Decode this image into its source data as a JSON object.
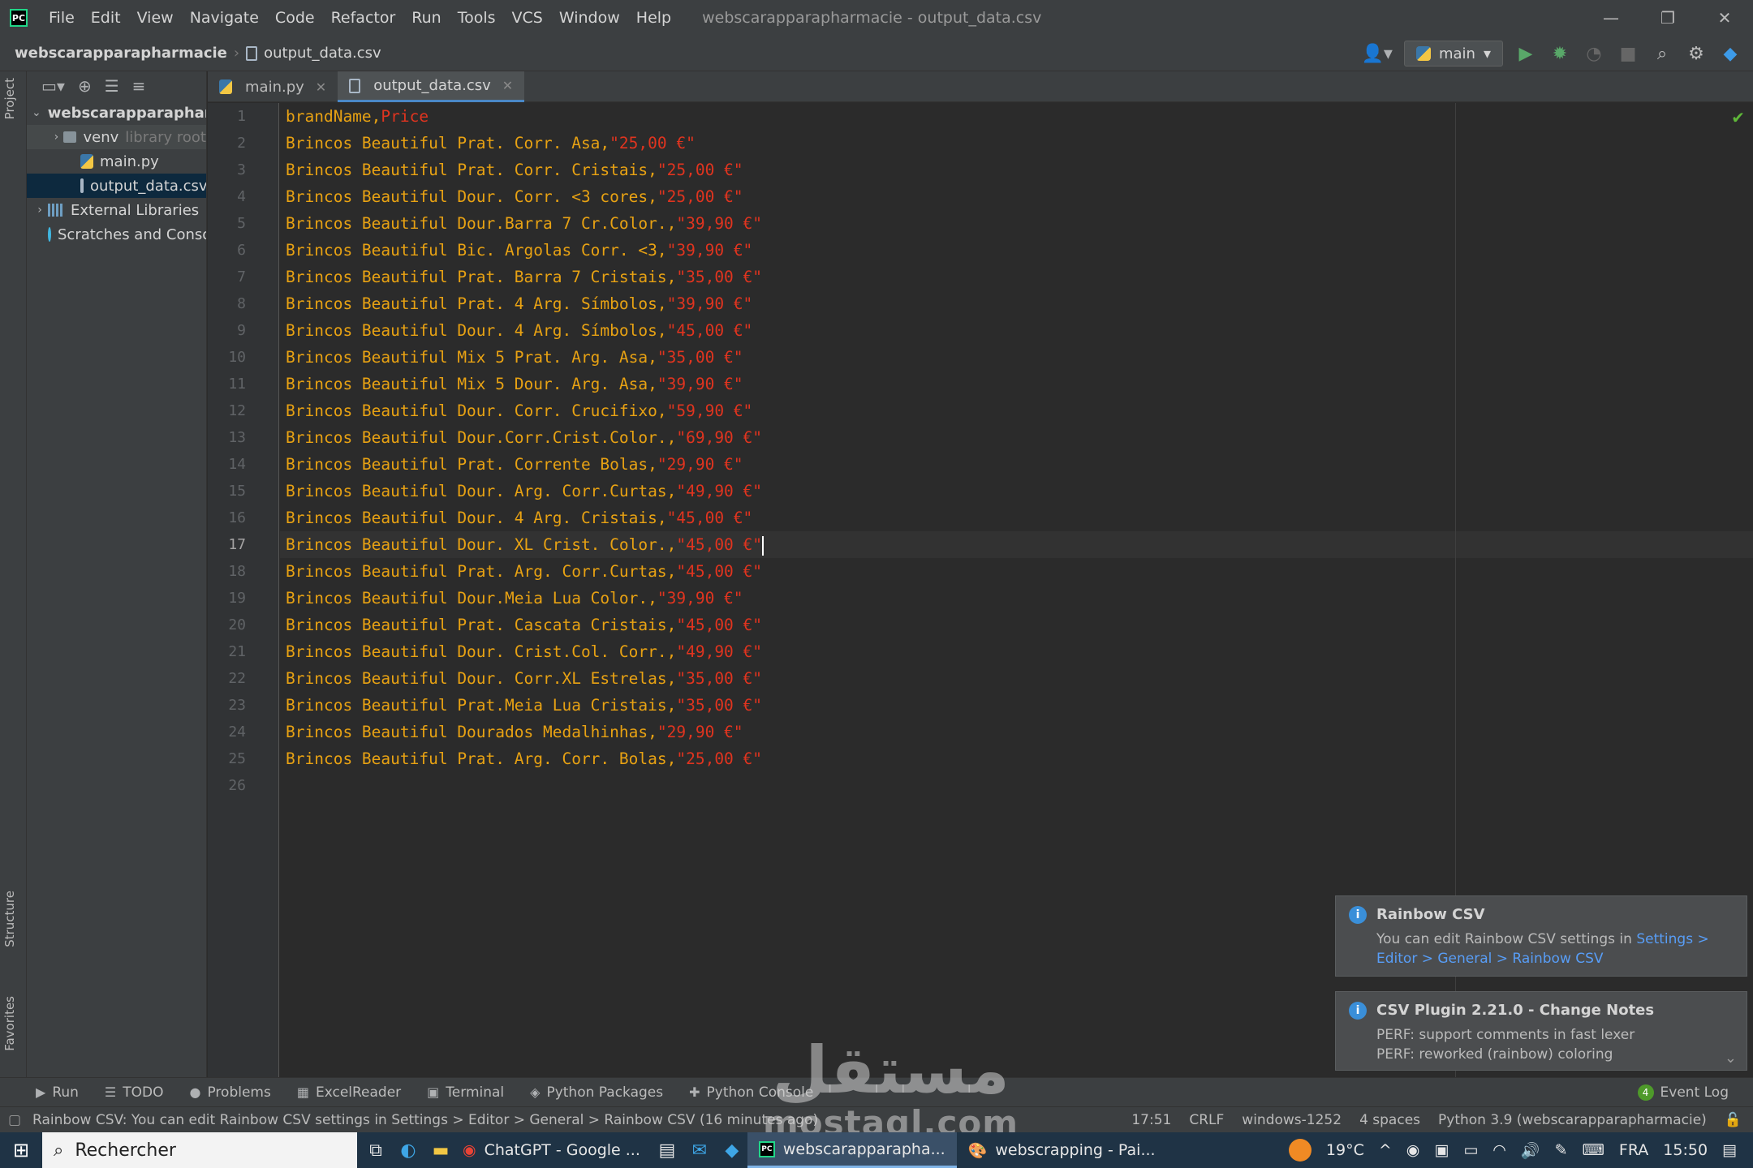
{
  "window": {
    "title": "webscarapparapharmacie - output_data.csv",
    "menu": [
      "File",
      "Edit",
      "View",
      "Navigate",
      "Code",
      "Refactor",
      "Run",
      "Tools",
      "VCS",
      "Window",
      "Help"
    ],
    "controls": {
      "minimize": "—",
      "restore": "❐",
      "close": "✕"
    }
  },
  "navbar": {
    "project": "webscarapparapharmacie",
    "file": "output_data.csv",
    "run_config": "main"
  },
  "left_strip": {
    "project": "Project",
    "structure": "Structure",
    "favorites": "Favorites"
  },
  "project_tree": {
    "root": "webscarapparapharmacie",
    "venv": "venv",
    "venv_hint": "library root",
    "main": "main.py",
    "csv": "output_data.csv",
    "libraries": "External Libraries",
    "scratches": "Scratches and Consoles"
  },
  "tabs": [
    {
      "label": "main.py"
    },
    {
      "label": "output_data.csv"
    }
  ],
  "editor": {
    "current_line": 17,
    "lines": [
      {
        "n": "1",
        "a": "brandName",
        "b": "Price"
      },
      {
        "n": "2",
        "a": "Brincos Beautiful Prat. Corr. Asa",
        "b": "\"25,00 €\""
      },
      {
        "n": "3",
        "a": "Brincos Beautiful Prat. Corr. Cristais",
        "b": "\"25,00 €\""
      },
      {
        "n": "4",
        "a": "Brincos Beautiful Dour. Corr. <3 cores",
        "b": "\"25,00 €\""
      },
      {
        "n": "5",
        "a": "Brincos Beautiful Dour.Barra 7 Cr.Color.",
        "b": "\"39,90 €\""
      },
      {
        "n": "6",
        "a": "Brincos Beautiful Bic. Argolas Corr. <3",
        "b": "\"39,90 €\""
      },
      {
        "n": "7",
        "a": "Brincos Beautiful Prat. Barra 7 Cristais",
        "b": "\"35,00 €\""
      },
      {
        "n": "8",
        "a": "Brincos Beautiful Prat. 4 Arg. Símbolos",
        "b": "\"39,90 €\""
      },
      {
        "n": "9",
        "a": "Brincos Beautiful Dour. 4 Arg. Símbolos",
        "b": "\"45,00 €\""
      },
      {
        "n": "10",
        "a": "Brincos Beautiful Mix 5 Prat. Arg. Asa",
        "b": "\"35,00 €\""
      },
      {
        "n": "11",
        "a": "Brincos Beautiful Mix 5 Dour. Arg. Asa",
        "b": "\"39,90 €\""
      },
      {
        "n": "12",
        "a": "Brincos Beautiful Dour. Corr. Crucifixo",
        "b": "\"59,90 €\""
      },
      {
        "n": "13",
        "a": "Brincos Beautiful Dour.Corr.Crist.Color.",
        "b": "\"69,90 €\""
      },
      {
        "n": "14",
        "a": "Brincos Beautiful Prat. Corrente Bolas",
        "b": "\"29,90 €\""
      },
      {
        "n": "15",
        "a": "Brincos Beautiful Dour. Arg. Corr.Curtas",
        "b": "\"49,90 €\""
      },
      {
        "n": "16",
        "a": "Brincos Beautiful Dour. 4 Arg. Cristais",
        "b": "\"45,00 €\""
      },
      {
        "n": "17",
        "a": "Brincos Beautiful Dour. XL Crist. Color.",
        "b": "\"45,00 €\""
      },
      {
        "n": "18",
        "a": "Brincos Beautiful Prat. Arg. Corr.Curtas",
        "b": "\"45,00 €\""
      },
      {
        "n": "19",
        "a": "Brincos Beautiful Dour.Meia Lua Color.",
        "b": "\"39,90 €\""
      },
      {
        "n": "20",
        "a": "Brincos Beautiful Prat. Cascata Cristais",
        "b": "\"45,00 €\""
      },
      {
        "n": "21",
        "a": "Brincos Beautiful Dour. Crist.Col. Corr.",
        "b": "\"49,90 €\""
      },
      {
        "n": "22",
        "a": "Brincos Beautiful Dour. Corr.XL Estrelas",
        "b": "\"35,00 €\""
      },
      {
        "n": "23",
        "a": "Brincos Beautiful Prat.Meia Lua Cristais",
        "b": "\"35,00 €\""
      },
      {
        "n": "24",
        "a": "Brincos Beautiful Dourados Medalhinhas",
        "b": "\"29,90 €\""
      },
      {
        "n": "25",
        "a": "Brincos Beautiful Prat. Arg. Corr. Bolas",
        "b": "\"25,00 €\""
      },
      {
        "n": "26",
        "a": "",
        "b": ""
      }
    ]
  },
  "notifications": {
    "rainbow": {
      "title": "Rainbow CSV",
      "text": "You can edit Rainbow CSV settings in",
      "link": "Settings > Editor > General > Rainbow CSV"
    },
    "csv_plugin": {
      "title": "CSV Plugin 2.21.0 - Change Notes",
      "line1": "PERF: support comments in fast lexer",
      "line2": "PERF: reworked (rainbow) coloring"
    }
  },
  "tool_tabs": [
    "Run",
    "TODO",
    "Problems",
    "ExcelReader",
    "Terminal",
    "Python Packages",
    "Python Console"
  ],
  "event_log": {
    "label": "Event Log",
    "count": "4"
  },
  "status": {
    "message": "Rainbow CSV: You can edit Rainbow CSV settings in Settings > Editor > General > Rainbow CSV (16 minutes ago)",
    "position": "17:51",
    "line_sep": "CRLF",
    "encoding": "windows-1252",
    "indent": "4 spaces",
    "interpreter": "Python 3.9 (webscarapparapharmacie)"
  },
  "taskbar": {
    "search": "Rechercher",
    "apps": [
      "ChatGPT - Google ...",
      "webscarapparapha...",
      "webscrapping - Pai..."
    ],
    "temp": "19°C",
    "lang": "FRA",
    "time": "15:50"
  },
  "watermark": {
    "arabic": "مستقل",
    "latin": "mostaql.com"
  },
  "colors": {
    "column1": "#e8a213",
    "column2": "#e0341f",
    "background": "#2b2b2b",
    "panel": "#3c3f41"
  }
}
